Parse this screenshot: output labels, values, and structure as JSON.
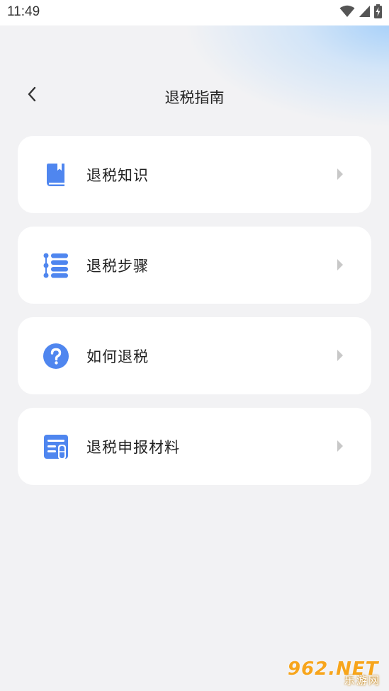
{
  "status_bar": {
    "time": "11:49",
    "icons": [
      "wifi-icon",
      "signal-icon",
      "battery-charging-icon"
    ]
  },
  "header": {
    "title": "退税指南",
    "back_icon": "chevron-left-icon"
  },
  "menu": [
    {
      "label": "退税知识",
      "icon": "book-icon"
    },
    {
      "label": "退税步骤",
      "icon": "list-icon"
    },
    {
      "label": "如何退税",
      "icon": "question-circle-icon"
    },
    {
      "label": "退税申报材料",
      "icon": "form-icon"
    }
  ],
  "colors": {
    "accent": "#4f86ef",
    "background": "#f2f2f4",
    "card": "#ffffff",
    "chevron": "#c8c8c8",
    "watermark": "#f7a51c"
  },
  "watermark": {
    "main": "962.NET",
    "sub": "乐游网"
  }
}
